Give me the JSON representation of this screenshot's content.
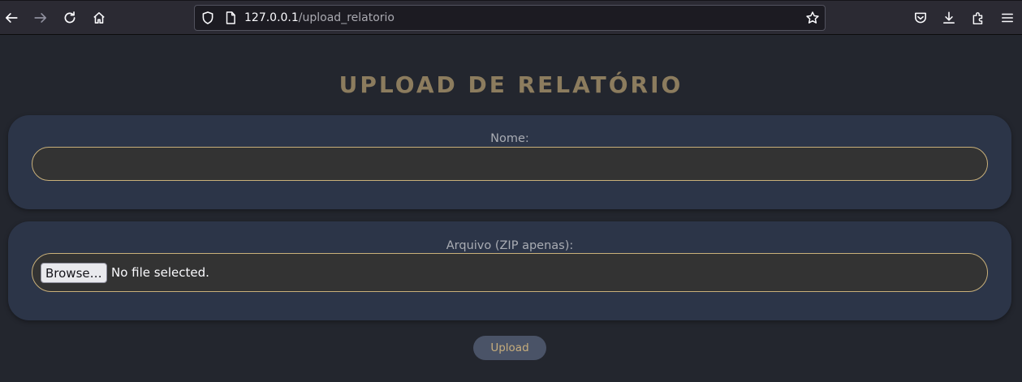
{
  "browser": {
    "url_host": "127.0.0.1",
    "url_path": "/upload_relatorio",
    "icons": {
      "back": "back-arrow-icon",
      "forward": "forward-arrow-icon",
      "reload": "reload-icon",
      "home": "home-icon",
      "shield": "tracking-protection-shield-icon",
      "page": "page-info-icon",
      "bookmark": "bookmark-star-icon",
      "pocket": "pocket-icon",
      "downloads": "download-icon",
      "extensions": "extensions-icon",
      "menu": "hamburger-menu-icon"
    }
  },
  "page": {
    "title": "UPLOAD DE RELATÓRIO",
    "nome": {
      "label": "Nome:",
      "value": "",
      "placeholder": ""
    },
    "arquivo": {
      "label": "Arquivo (ZIP apenas):",
      "browse_label": "Browse…",
      "status": "No file selected."
    },
    "upload_label": "Upload"
  },
  "colors": {
    "background": "#23262e",
    "card": "#2c3548",
    "accent_gold": "#c9b07a",
    "title": "#8c7c5e",
    "button": "#4a5367"
  }
}
